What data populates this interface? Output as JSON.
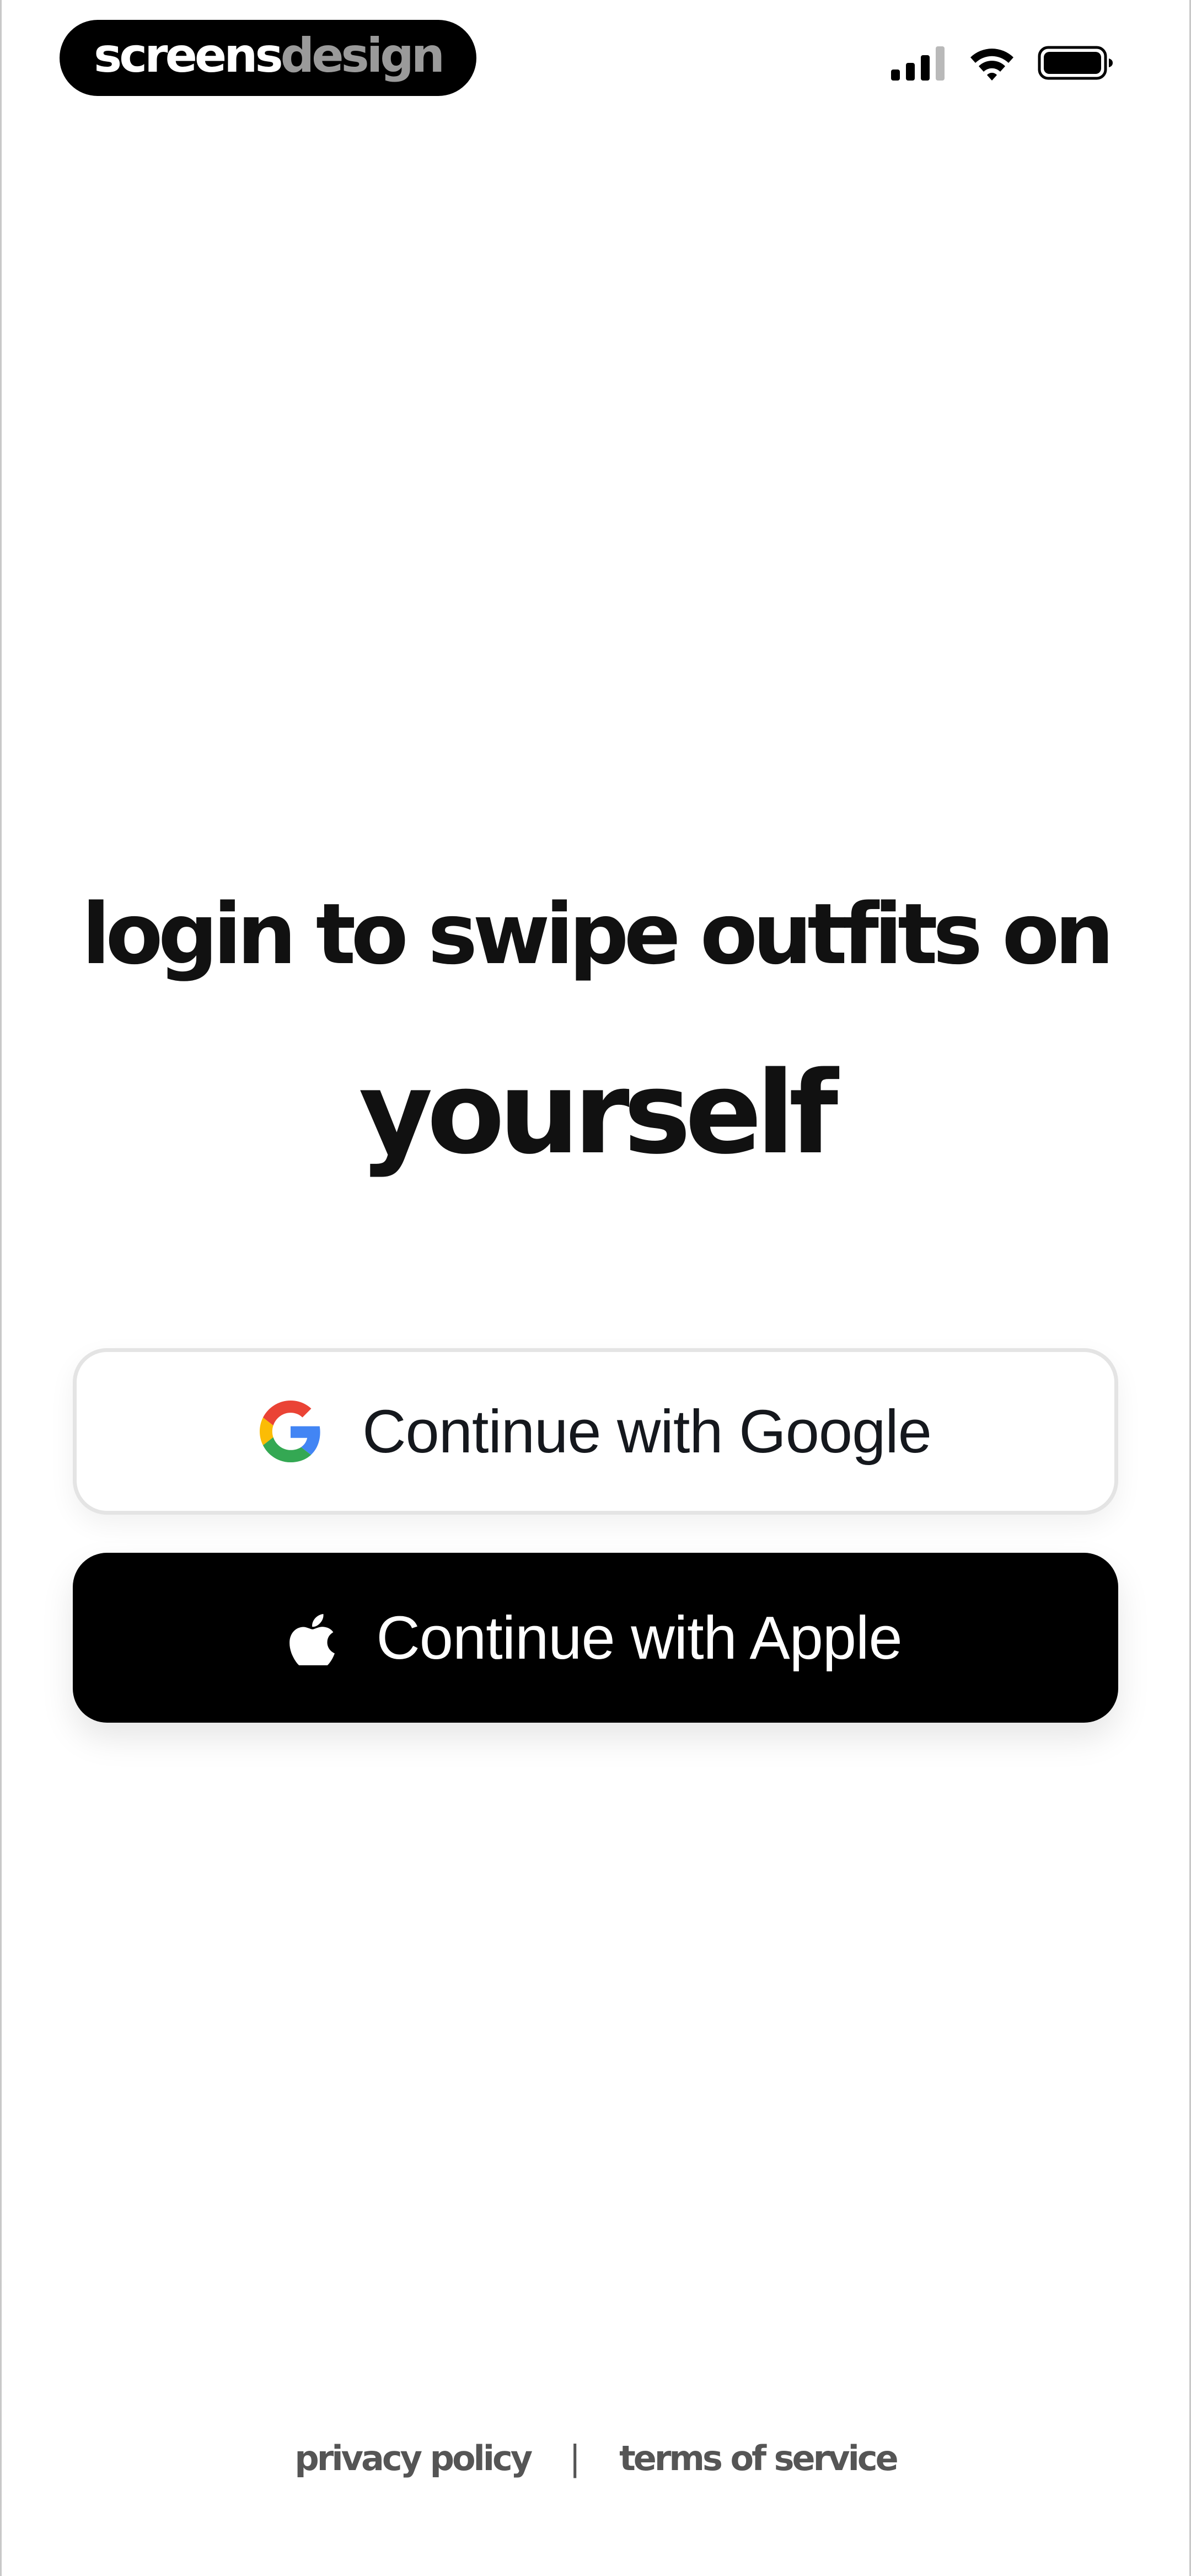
{
  "status_bar": {
    "brand_part1": "screens",
    "brand_part2": "design",
    "icons": [
      "cellular-signal-icon",
      "wifi-icon",
      "battery-icon"
    ]
  },
  "headline": {
    "line1": "login to swipe outfits on",
    "line2": "yourself"
  },
  "buttons": {
    "google_label": "Continue with Google",
    "google_icon": "google-logo-icon",
    "apple_label": "Continue with Apple",
    "apple_icon": "apple-logo-icon"
  },
  "footer": {
    "privacy": "privacy policy",
    "separator": "|",
    "terms": "terms of service"
  },
  "colors": {
    "background": "#ffffff",
    "text": "#111111",
    "apple_button": "#000000",
    "google_border": "#e4e4e4",
    "footer_text": "#555555"
  }
}
